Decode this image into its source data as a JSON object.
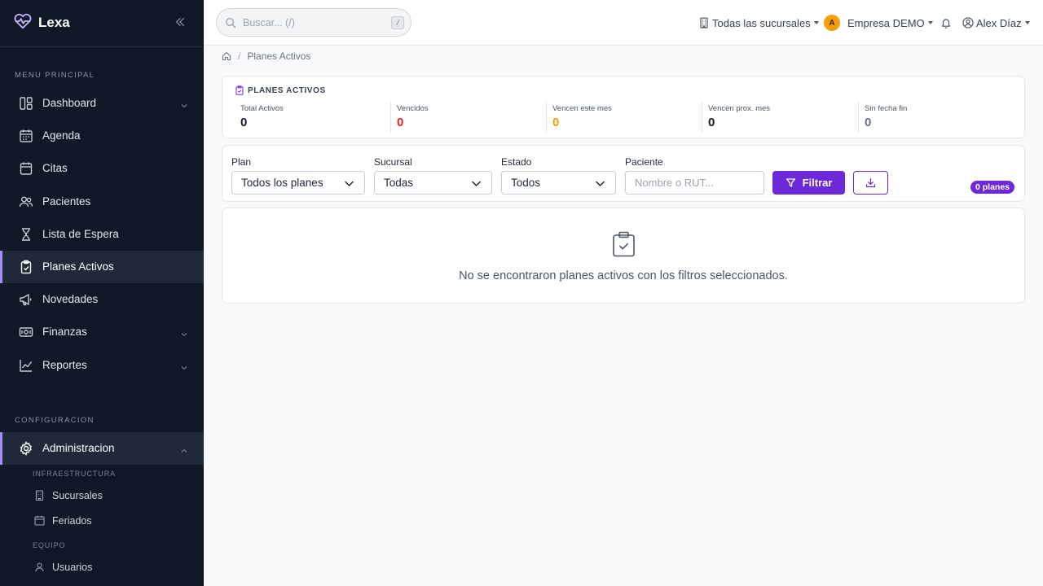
{
  "brand": {
    "name": "Lexa",
    "accent": "#a78bfa"
  },
  "sidebar": {
    "section_main": "MENU PRINCIPAL",
    "items": [
      {
        "label": "Dashboard",
        "icon": "dashboard-icon",
        "has_chevron": true
      },
      {
        "label": "Agenda",
        "icon": "calendar-grid-icon"
      },
      {
        "label": "Citas",
        "icon": "calendar-icon"
      },
      {
        "label": "Pacientes",
        "icon": "users-icon"
      },
      {
        "label": "Lista de Espera",
        "icon": "hourglass-icon"
      },
      {
        "label": "Planes Activos",
        "icon": "clipboard-check-icon",
        "active": true
      },
      {
        "label": "Novedades",
        "icon": "megaphone-icon"
      },
      {
        "label": "Finanzas",
        "icon": "cash-icon",
        "has_chevron": true
      },
      {
        "label": "Reportes",
        "icon": "chart-line-icon",
        "has_chevron": true
      }
    ],
    "section_config": "CONFIGURACION",
    "admin": {
      "label": "Administracion",
      "icon": "gear-icon",
      "expanded": true
    },
    "sub_infra": "INFRAESTRUCTURA",
    "infra_items": [
      {
        "label": "Sucursales",
        "icon": "building-icon"
      },
      {
        "label": "Feriados",
        "icon": "calendar-icon"
      }
    ],
    "sub_team": "EQUIPO",
    "team_items": [
      {
        "label": "Usuarios",
        "icon": "user-icon"
      }
    ]
  },
  "header": {
    "search_placeholder": "Buscar... (/)",
    "search_shortcut": "/",
    "branch_selector": "Todas las sucursales",
    "company_initial": "A",
    "company_name": "Empresa DEMO",
    "user_name": "Alex Díaz"
  },
  "breadcrumb": {
    "current": "Planes Activos"
  },
  "stats": {
    "title": "PLANES ACTIVOS",
    "items": [
      {
        "label": "Total Activos",
        "value": "0",
        "color": "#111827"
      },
      {
        "label": "Vencidos",
        "value": "0",
        "color": "#dc2626"
      },
      {
        "label": "Vencen este mes",
        "value": "0",
        "color": "#f59e0b"
      },
      {
        "label": "Vencen prox. mes",
        "value": "0",
        "color": "#111827"
      },
      {
        "label": "Sin fecha fin",
        "value": "0",
        "color": "#64748b"
      }
    ]
  },
  "filters": {
    "plan_label": "Plan",
    "plan_value": "Todos los planes",
    "branch_label": "Sucursal",
    "branch_value": "Todas",
    "status_label": "Estado",
    "status_value": "Todos",
    "patient_label": "Paciente",
    "patient_placeholder": "Nombre o RUT...",
    "filter_button": "Filtrar",
    "count_badge": "0 planes"
  },
  "empty_state": {
    "message": "No se encontraron planes activos con los filtros seleccionados."
  },
  "colors": {
    "primary": "#6d28d9",
    "sidebar_bg": "#101828"
  }
}
